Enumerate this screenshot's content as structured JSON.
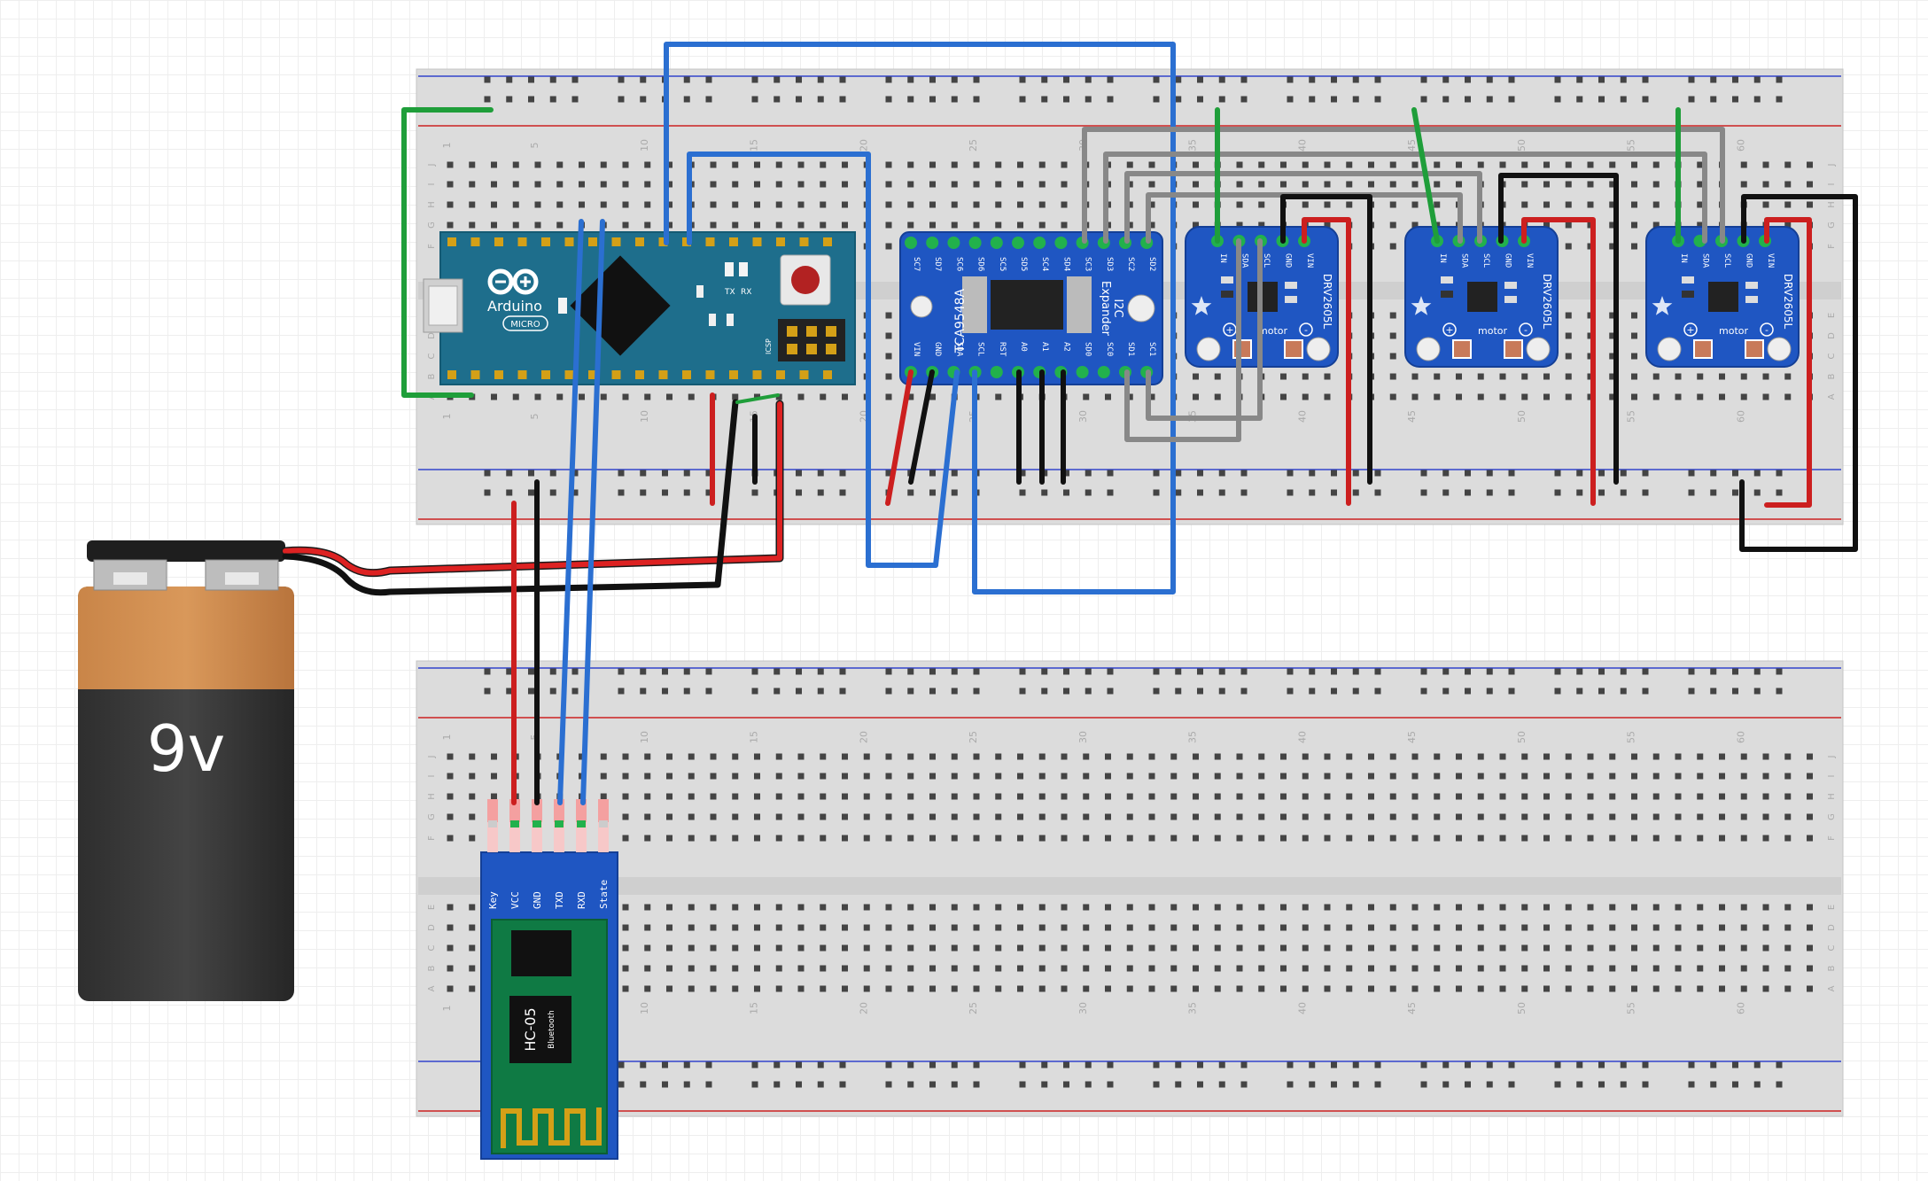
{
  "battery": {
    "label": "9v"
  },
  "arduino": {
    "brand": "Arduino",
    "model": "MICRO",
    "tx": "TX",
    "rx": "RX",
    "icsp": "ICSP"
  },
  "mux": {
    "chip": "TCA9548A",
    "title1": "I2C",
    "title2": "Expander",
    "top_pins": [
      "SC7",
      "SD7",
      "SC6",
      "SD6",
      "SC5",
      "SD5",
      "SC4",
      "SD4",
      "SC3",
      "SD3",
      "SC2",
      "SD2"
    ],
    "bottom_pins": [
      "VIN",
      "GND",
      "SDA",
      "SCL",
      "RST",
      "A0",
      "A1",
      "A2",
      "SD0",
      "SC0",
      "SD1",
      "SC1"
    ]
  },
  "haptic": {
    "chip": "DRV2605L",
    "pins": [
      "IN",
      "SDA",
      "SCL",
      "GND",
      "VIN"
    ],
    "motor_label": "motor",
    "plus": "+",
    "minus": "-"
  },
  "bluetooth": {
    "model": "HC-05",
    "sub": "Bluetooth",
    "pins": [
      "Key",
      "VCC",
      "GND",
      "TXD",
      "RXD",
      "State"
    ]
  },
  "breadboard": {
    "col_numbers": [
      "1",
      "5",
      "10",
      "15",
      "20",
      "25",
      "30",
      "35",
      "40",
      "45",
      "50",
      "55",
      "60"
    ],
    "row_letters_top": [
      "J",
      "I",
      "H",
      "G",
      "F"
    ],
    "row_letters_bottom": [
      "E",
      "D",
      "C",
      "B",
      "A"
    ]
  }
}
